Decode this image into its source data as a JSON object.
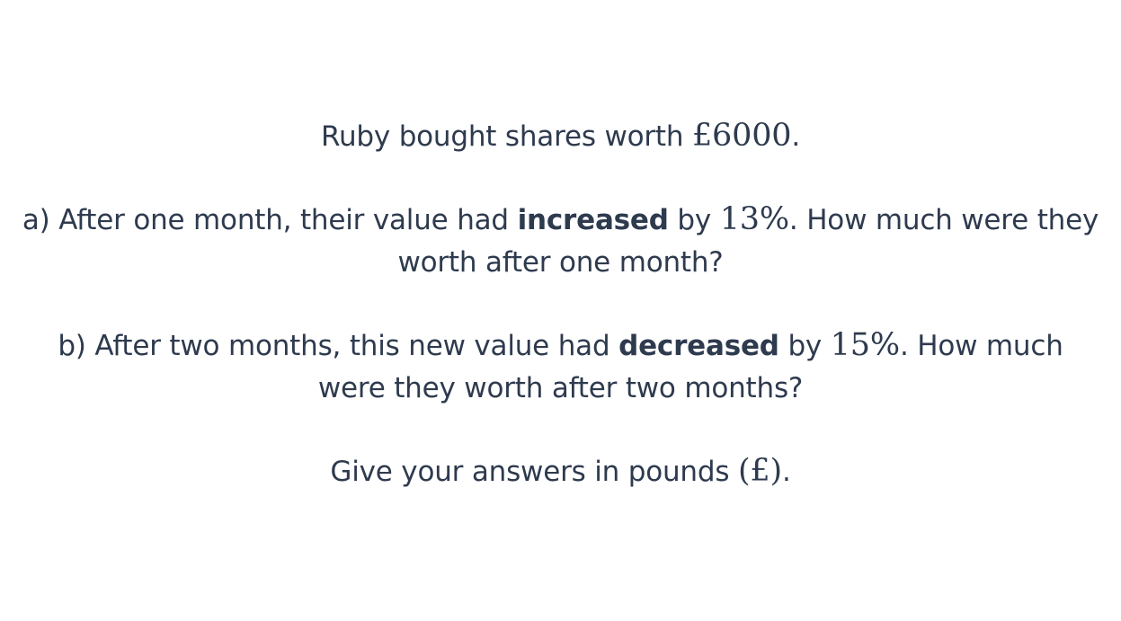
{
  "intro": {
    "text_before": "Ruby bought shares worth ",
    "amount": "£6000",
    "text_after": "."
  },
  "part_a": {
    "prefix": "a) After one month, their value had ",
    "keyword": "increased",
    "middle": " by ",
    "percent": "13%",
    "suffix": ". How much were they worth after one month?"
  },
  "part_b": {
    "prefix": "b) After two months, this new value had ",
    "keyword": "decreased",
    "middle": " by ",
    "percent": "15%",
    "suffix": ". How much were they worth after two months?"
  },
  "instruction": {
    "text_before": "Give your answers in pounds ",
    "unit": "(£)",
    "text_after": "."
  },
  "colors": {
    "text": "#2e3a4e",
    "background": "#ffffff"
  }
}
